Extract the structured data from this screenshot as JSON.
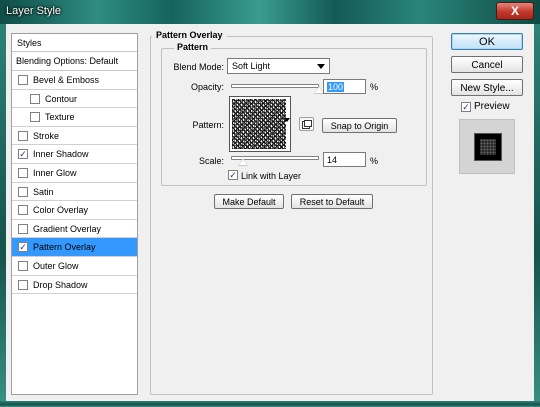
{
  "window": {
    "title": "Layer Style",
    "close_glyph": "X"
  },
  "styles_panel": {
    "header": "Styles",
    "blending": "Blending Options: Default",
    "items": [
      {
        "label": "Bevel & Emboss",
        "checked": false,
        "indent": false,
        "selected": false
      },
      {
        "label": "Contour",
        "checked": false,
        "indent": true,
        "selected": false
      },
      {
        "label": "Texture",
        "checked": false,
        "indent": true,
        "selected": false
      },
      {
        "label": "Stroke",
        "checked": false,
        "indent": false,
        "selected": false
      },
      {
        "label": "Inner Shadow",
        "checked": true,
        "indent": false,
        "selected": false
      },
      {
        "label": "Inner Glow",
        "checked": false,
        "indent": false,
        "selected": false
      },
      {
        "label": "Satin",
        "checked": false,
        "indent": false,
        "selected": false
      },
      {
        "label": "Color Overlay",
        "checked": false,
        "indent": false,
        "selected": false
      },
      {
        "label": "Gradient Overlay",
        "checked": false,
        "indent": false,
        "selected": false
      },
      {
        "label": "Pattern Overlay",
        "checked": true,
        "indent": false,
        "selected": true
      },
      {
        "label": "Outer Glow",
        "checked": false,
        "indent": false,
        "selected": false
      },
      {
        "label": "Drop Shadow",
        "checked": false,
        "indent": false,
        "selected": false
      }
    ]
  },
  "pattern_overlay": {
    "group_title": "Pattern Overlay",
    "subgroup_title": "Pattern",
    "blend_mode_label": "Blend Mode:",
    "blend_mode_value": "Soft Light",
    "opacity_label": "Opacity:",
    "opacity_value": "100",
    "opacity_level_percent": 100,
    "percent": "%",
    "pattern_label": "Pattern:",
    "snap_button": "Snap to Origin",
    "scale_label": "Scale:",
    "scale_value": "14",
    "scale_level_percent": 14,
    "link_label": "Link with Layer",
    "link_checked": true,
    "make_default": "Make Default",
    "reset_default": "Reset to Default"
  },
  "actions": {
    "ok": "OK",
    "cancel": "Cancel",
    "new_style": "New Style...",
    "preview_label": "Preview",
    "preview_checked": true
  },
  "check_glyph": "✓",
  "colors": {
    "selection": "#3399ff",
    "title_bar": "#1f6e66"
  }
}
